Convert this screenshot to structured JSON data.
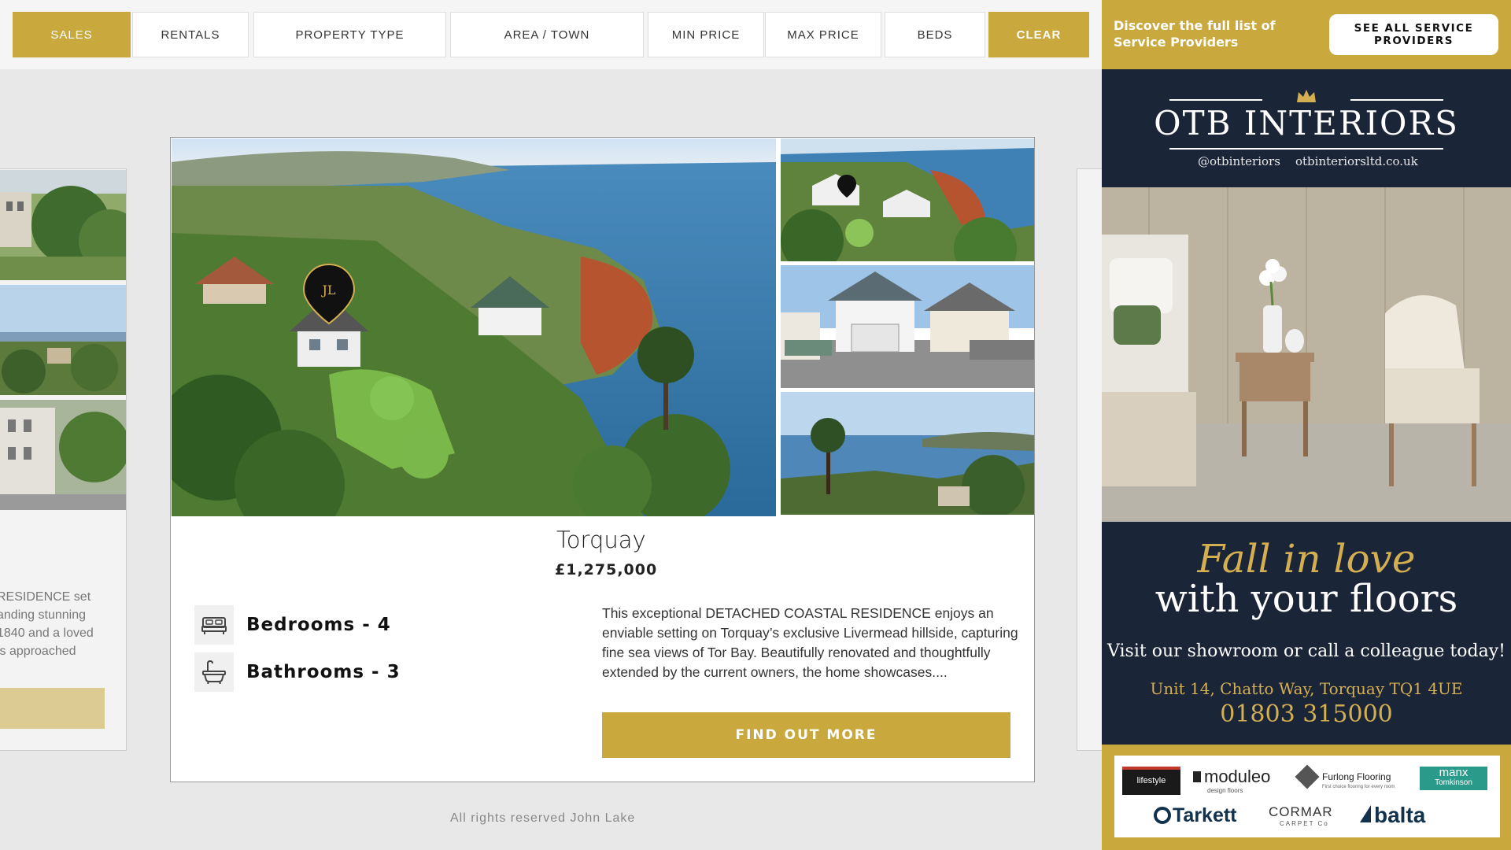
{
  "filters": {
    "sales": "SALES",
    "rentals": "RENTALS",
    "property_type": "PROPERTY TYPE",
    "area": "AREA / TOWN",
    "min_price": "MIN PRICE",
    "max_price": "MAX PRICE",
    "beds": "BEDS",
    "clear": "CLEAR"
  },
  "left_card": {
    "text_lines": [
      "RESIDENCE set",
      "anding stunning",
      "1840 and a loved",
      "is approached"
    ]
  },
  "listing": {
    "town": "Torquay",
    "price": "£1,275,000",
    "bedrooms": "Bedrooms - 4",
    "bathrooms": "Bathrooms - 3",
    "description": "This exceptional DETACHED COASTAL RESIDENCE enjoys an enviable setting on Torquay’s exclusive Livermead hillside, capturing fine sea views of Tor Bay. Beautifully renovated and thoughtfully extended by the current owners, the home showcases....",
    "cta": "FIND OUT MORE",
    "marker_letters": "JL"
  },
  "footer": {
    "copyright": "All rights reserved John Lake"
  },
  "providers": {
    "discover_text": "Discover the full list of Service Providers",
    "see_all": "SEE ALL SERVICE PROVIDERS"
  },
  "ad": {
    "brand": "OTB INTERIORS",
    "handle": "@otbinteriors",
    "website": "otbinteriorsltd.co.uk",
    "tagline_1": "Fall in love",
    "tagline_2": "with your floors",
    "visit": "Visit our showroom or call a colleague today!",
    "address": "Unit 14, Chatto Way, Torquay TQ1 4UE",
    "phone": "01803 315000",
    "logos": {
      "lifestyle": "lifestyle",
      "moduleo": "moduleo",
      "moduleo_sub": "design floors",
      "furlong": "Furlong Flooring",
      "furlong_sub": "First choice flooring for every room",
      "manx_1": "manx",
      "manx_2": "Tomkinson",
      "tarkett": "Tarkett",
      "cormar": "CORMAR",
      "cormar_sub": "CARPET Co",
      "balta": "balta"
    }
  },
  "colors": {
    "gold": "#c9a83e",
    "navy": "#1b2538",
    "ad_gold_text": "#d4af52"
  }
}
